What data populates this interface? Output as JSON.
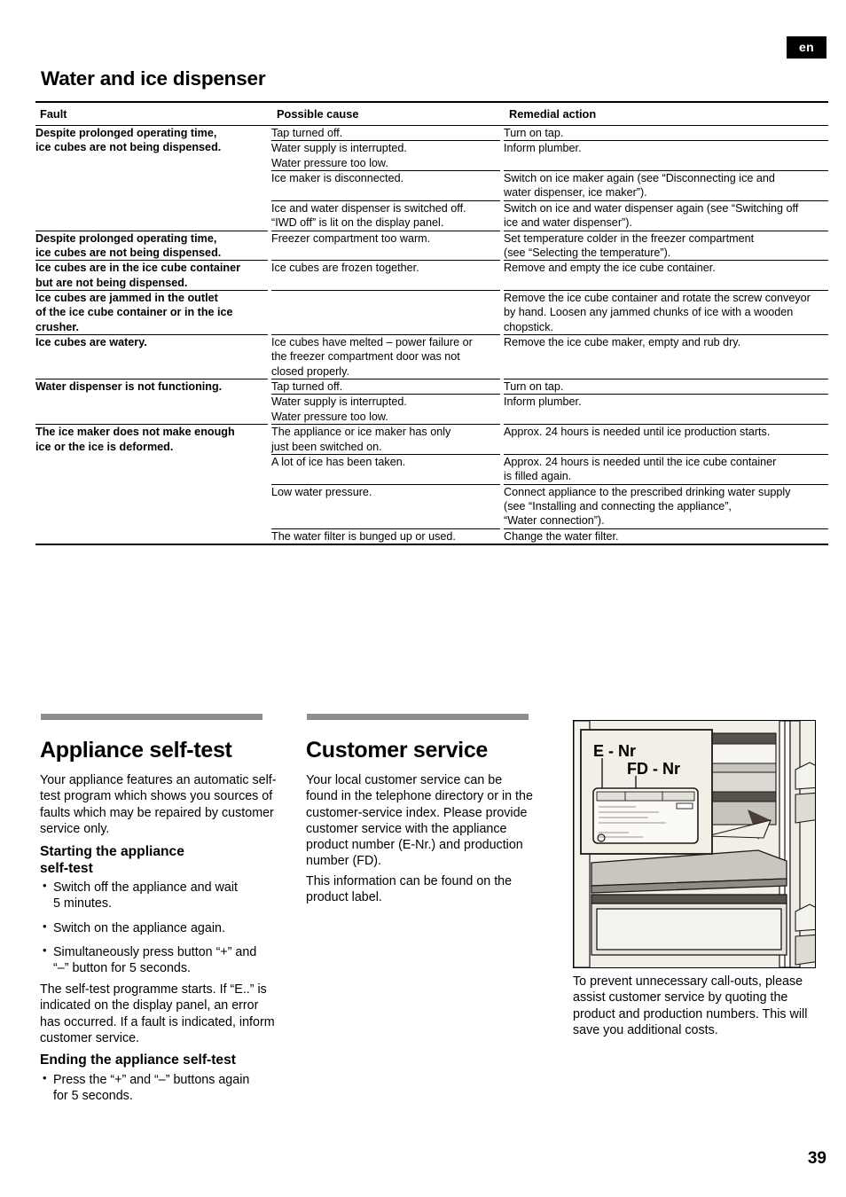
{
  "page": {
    "language_badge": "en",
    "page_number": "39"
  },
  "section": {
    "title": "Water and ice dispenser"
  },
  "table": {
    "headers": [
      "Fault",
      "Possible cause",
      "Remedial action"
    ],
    "rows": [
      {
        "fault": "Despite prolonged operating time,\nice cubes are not being dispensed.",
        "fault_rowspan": 4,
        "cause": "Tap turned off.",
        "action": "Turn on tap."
      },
      {
        "fault": "",
        "cause": "Water supply is interrupted.\nWater pressure too low.",
        "action": "Inform plumber."
      },
      {
        "fault": "",
        "cause": "Ice maker is disconnected.",
        "action": "Switch on ice maker again (see “Disconnecting ice and\nwater dispenser, ice maker”)."
      },
      {
        "fault": "",
        "cause": "Ice and water dispenser is switched off.\n“IWD off” is lit on the display panel.",
        "action": "Switch on ice and water dispenser again (see “Switching off\nice and water dispenser”)."
      },
      {
        "fault": "Despite prolonged operating time,\nice cubes are not being dispensed.",
        "cause": "Freezer compartment too warm.",
        "action": "Set temperature colder in the freezer compartment\n(see “Selecting the temperature”)."
      },
      {
        "fault": "Ice cubes are in the ice cube container\nbut are not being dispensed.",
        "cause": "Ice cubes are frozen together.",
        "action": "Remove and empty the ice cube container."
      },
      {
        "fault": "Ice cubes are jammed in the outlet\nof the ice cube container or in the ice\ncrusher.",
        "cause": "",
        "action": "Remove the ice cube container and rotate the screw conveyor\nby hand. Loosen any jammed chunks of ice with a wooden\nchopstick."
      },
      {
        "fault": "Ice cubes are watery.",
        "cause": "Ice cubes have melted – power failure or\nthe freezer compartment door was not\nclosed properly.",
        "action": "Remove the ice cube maker, empty and rub dry."
      },
      {
        "fault": "Water dispenser is not functioning.",
        "fault_rowspan": 2,
        "cause": "Tap turned off.",
        "action": "Turn on tap."
      },
      {
        "fault": "",
        "cause": "Water supply is interrupted.\nWater pressure too low.",
        "action": "Inform plumber."
      },
      {
        "fault": "The ice maker does not make enough\nice or the ice is deformed.",
        "fault_rowspan": 4,
        "cause": "The appliance or ice maker has only\njust been switched on.",
        "action": "Approx. 24 hours is needed until ice production starts."
      },
      {
        "fault": "",
        "cause": "A lot of ice has been taken.",
        "action": "Approx. 24 hours is needed until the ice cube container\nis filled again."
      },
      {
        "fault": "",
        "cause": "Low water pressure.",
        "action": "Connect appliance to the prescribed drinking water supply\n(see “Installing and connecting the appliance”,\n“Water connection”)."
      },
      {
        "fault": "",
        "cause": "The water filter is bunged up or used.",
        "action": "Change the water filter."
      }
    ]
  },
  "self_test": {
    "title": "Appliance self-test",
    "intro": "Your appliance features an automatic self-test program which shows you sources of faults which may be repaired by customer service only.",
    "starting_title": "Starting the appliance\nself-test",
    "starting_steps": [
      "Switch off the appliance and wait\n5 minutes.",
      "Switch on the appliance again.",
      "Simultaneously press button “+” and\n“–” button for 5 seconds."
    ],
    "result_text": "The self-test programme starts. If “E..” is indicated on the display panel, an error has occurred. If a fault is indicated, inform customer service.",
    "ending_title": "Ending the appliance self-test",
    "ending_steps": [
      "Press the “+” and “–” buttons again\nfor 5 seconds."
    ]
  },
  "customer_service": {
    "title": "Customer service",
    "paragraph1": "Your local customer service can be found in the telephone directory or in the customer-service index. Please provide customer service with the appliance product number (E-Nr.) and production number (FD).",
    "paragraph2": "This information can be found on the product label.",
    "illustration": {
      "label_e_nr": "E - Nr",
      "label_fd_nr": "FD - Nr"
    },
    "caption": "To prevent unnecessary call-outs, please assist customer service by quoting the product and production numbers. This will save you additional costs."
  },
  "colors": {
    "grey_bar": "#8d8d8d",
    "badge_bg": "#000000",
    "illustration_bg": "#f2efe6"
  }
}
